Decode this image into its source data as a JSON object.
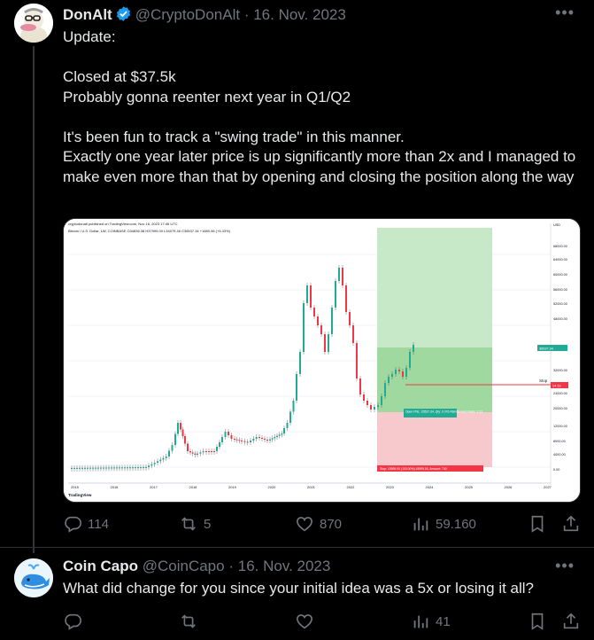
{
  "tweet1": {
    "author_name": "DonAlt",
    "handle": "@CryptoDonAlt",
    "separator": "·",
    "date": "16. Nov. 2023",
    "text": "Update:\n\nClosed at $37.5k\nProbably gonna reenter next year in Q1/Q2\n\nIt's been fun to track a \"swing trade\" in this manner.\nExactly one year later price is up significantly more than 2x and I managed to make even more than that by opening and closing the position along the way",
    "chart": {
      "header": "cryptodonalt published on TradingView.com, Nov 16, 2023 17:46 UTC",
      "symbol_line": "Bitcoin / U.S. Dollar, 1W, COINBASE  O34836.38 H37999.00 L34079.46 C36537.34 +1680.96 (+5.43%)",
      "years": [
        "2015",
        "2016",
        "2017",
        "2018",
        "2019",
        "2020",
        "2021",
        "2022",
        "2023",
        "2024",
        "2025",
        "2026",
        "2027"
      ],
      "price_labels": [
        "USD",
        "68000.00",
        "64000.00",
        "60000.00",
        "56000.00",
        "52000.00",
        "48000.00",
        "40000.00",
        "32000.00",
        "24000.00",
        "20000.00",
        "12000.00",
        "8000.00",
        "4000.00",
        "0.00"
      ],
      "stop_label": "Stop",
      "open_box": "Open PNL: 20537.34, Qty: 0.076\nRisk/Reward Ratio: 3.23",
      "stop_box": "Stop: 15999.00 (100.00%) 15999.00, Amount: 760",
      "right_tags": [
        "37124.0",
        "36537.34",
        "14:19"
      ],
      "logo": "TradingView",
      "accent_green": "#22ab94",
      "accent_red": "#f23645"
    },
    "stats": {
      "replies": "114",
      "reposts": "5",
      "likes": "870",
      "views": "59.160"
    }
  },
  "tweet2": {
    "author_name": "Coin Capo",
    "handle": "@CoinCapo",
    "separator": "·",
    "date": "16. Nov. 2023",
    "text": "What did change for you since your initial idea was a 5x or losing it all?",
    "stats": {
      "replies": "",
      "reposts": "",
      "likes": "",
      "views": "41"
    }
  },
  "colors": {
    "verified": "#1d9bf0",
    "muted": "#71767b",
    "text": "#e7e9ea",
    "background": "#000000"
  }
}
